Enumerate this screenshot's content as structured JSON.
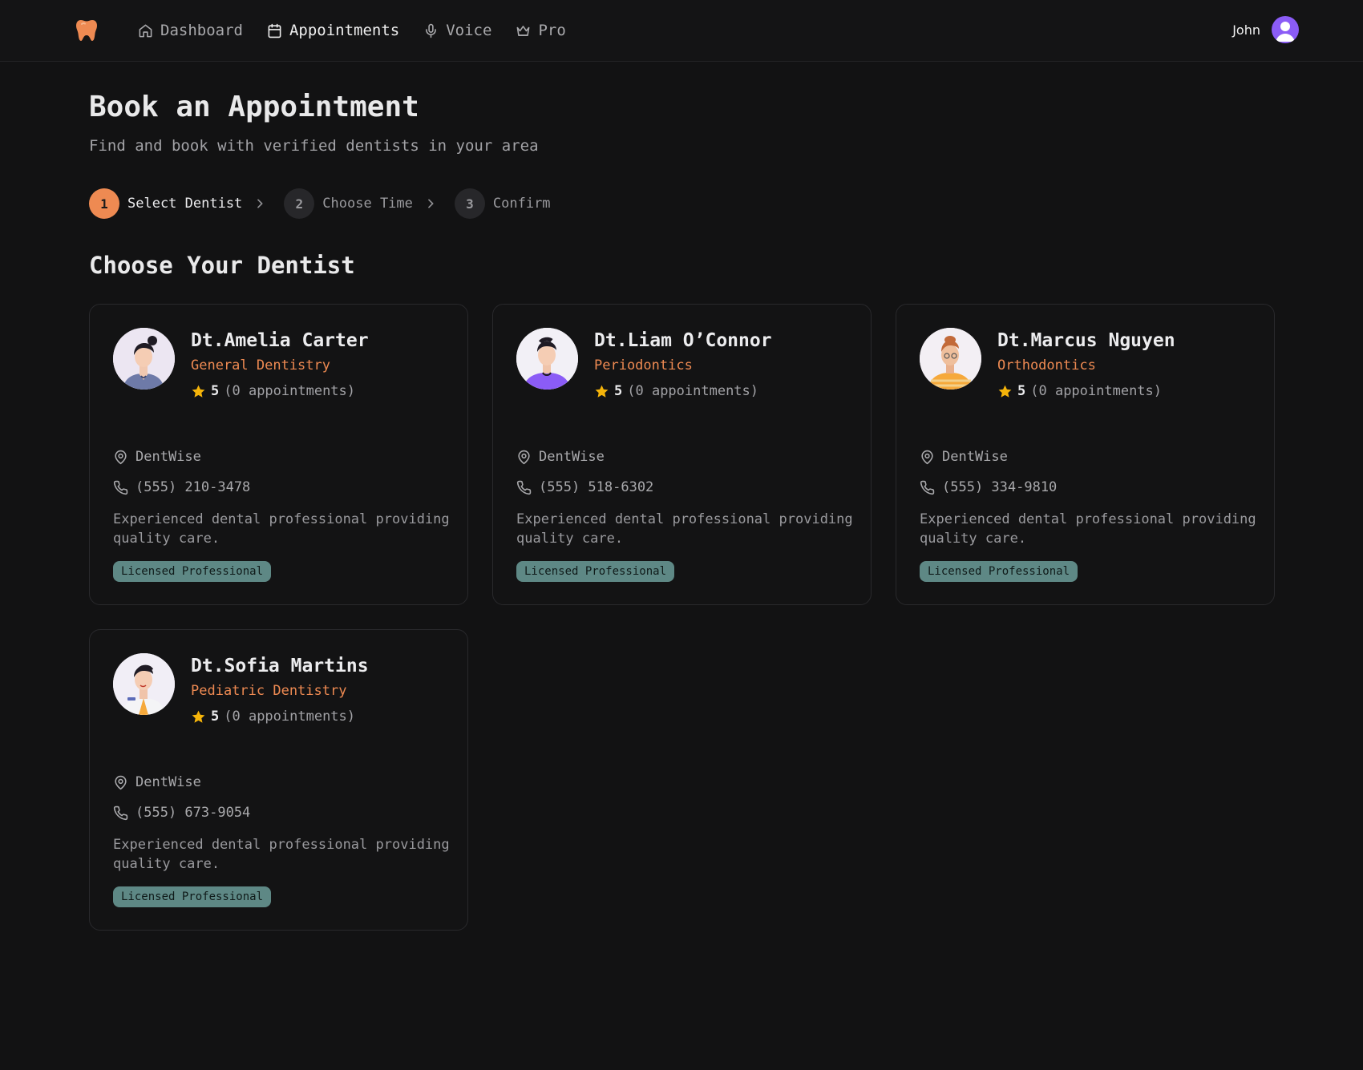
{
  "nav": {
    "items": [
      {
        "label": "Dashboard",
        "icon": "home-icon"
      },
      {
        "label": "Appointments",
        "icon": "calendar-icon",
        "active": true
      },
      {
        "label": "Voice",
        "icon": "microphone-icon"
      },
      {
        "label": "Pro",
        "icon": "crown-icon"
      }
    ],
    "user_name": "John"
  },
  "header": {
    "title": "Book an Appointment",
    "subtitle": "Find and book with verified dentists in your area"
  },
  "steps": [
    {
      "number": "1",
      "label": "Select Dentist",
      "active": true
    },
    {
      "number": "2",
      "label": "Choose Time",
      "active": false
    },
    {
      "number": "3",
      "label": "Confirm",
      "active": false
    }
  ],
  "section_title": "Choose Your Dentist",
  "dentists": [
    {
      "name": "Dt.Amelia Carter",
      "specialty": "General Dentistry",
      "rating": "5",
      "appointments": "(0 appointments)",
      "location": "DentWise",
      "phone": "(555) 210-3478",
      "description": "Experienced dental professional providing quality care.",
      "badge": "Licensed Professional"
    },
    {
      "name": "Dt.Liam O’Connor",
      "specialty": "Periodontics",
      "rating": "5",
      "appointments": "(0 appointments)",
      "location": "DentWise",
      "phone": "(555) 518-6302",
      "description": "Experienced dental professional providing quality care.",
      "badge": "Licensed Professional"
    },
    {
      "name": "Dt.Marcus Nguyen",
      "specialty": "Orthodontics",
      "rating": "5",
      "appointments": "(0 appointments)",
      "location": "DentWise",
      "phone": "(555) 334-9810",
      "description": "Experienced dental professional providing quality care.",
      "badge": "Licensed Professional"
    },
    {
      "name": "Dt.Sofia Martins",
      "specialty": "Pediatric Dentistry",
      "rating": "5",
      "appointments": "(0 appointments)",
      "location": "DentWise",
      "phone": "(555) 673-9054",
      "description": "Experienced dental professional providing quality care.",
      "badge": "Licensed Professional"
    }
  ],
  "colors": {
    "accent": "#ee8a52",
    "background": "#121213",
    "badge": "#5e8885",
    "star": "#f5b40a",
    "user_avatar": "#8b5cf6"
  }
}
